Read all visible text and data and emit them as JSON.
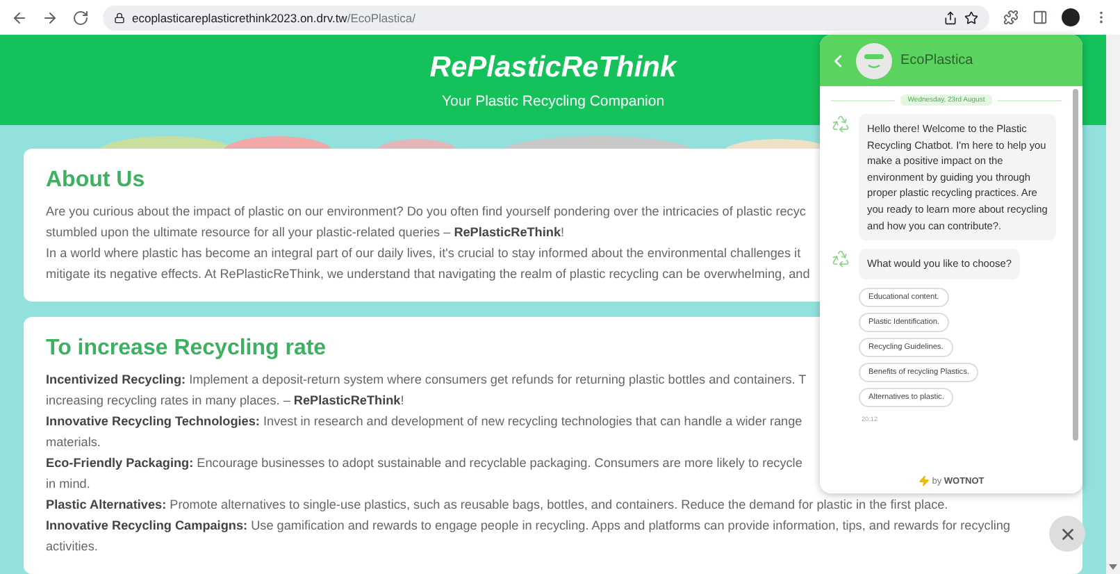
{
  "browser": {
    "url_host": "ecoplasticareplasticrethink2023.on.drv.tw",
    "url_path": "/EcoPlastica/"
  },
  "header": {
    "title": "RePlasticReThink",
    "subtitle": "Your Plastic Recycling Companion"
  },
  "sections": [
    {
      "heading": "About Us",
      "lines": [
        "Are you curious about the impact of plastic on our environment? Do you often find yourself pondering over the intricacies of plastic recyc",
        "stumbled upon the ultimate resource for all your plastic-related queries – **RePlasticReThink**!",
        "In a world where plastic has become an integral part of our daily lives, it's crucial to stay informed about the environmental challenges it",
        "mitigate its negative effects. At RePlasticReThink, we understand that navigating the realm of plastic recycling can be overwhelming, and"
      ]
    },
    {
      "heading": "To increase Recycling rate",
      "lines": [
        "**Incentivized Recycling:** Implement a deposit-return system where consumers get refunds for returning plastic bottles and containers. T",
        "increasing recycling rates in many places. – **RePlasticReThink**!",
        "**Innovative Recycling Technologies:** Invest in research and development of new recycling technologies that can handle a wider range",
        "materials.",
        "**Eco-Friendly Packaging:** Encourage businesses to adopt sustainable and recyclable packaging. Consumers are more likely to recycle",
        "in mind.",
        "**Plastic Alternatives:** Promote alternatives to single-use plastics, such as reusable bags, bottles, and containers. Reduce the demand for plastic in the first place.",
        "**Innovative Recycling Campaigns:** Use gamification and rewards to engage people in recycling. Apps and platforms can provide information, tips, and rewards for recycling",
        "activities."
      ]
    }
  ],
  "chat": {
    "title": "EcoPlastica",
    "date": "Wednesday, 23rd August",
    "messages": [
      {
        "text": "Hello there! Welcome to the Plastic Recycling Chatbot. I'm here to help you make a positive impact on the environment by guiding you through proper plastic recycling practices. Are you ready to learn more about recycling and how you can contribute?."
      },
      {
        "text": "What would you like to choose?"
      }
    ],
    "options": [
      "Educational content.",
      "Plastic Identification.",
      "Recycling Guidelines.",
      "Benefits of recycling Plastics.",
      "Alternatives to plastic."
    ],
    "time": "20:12",
    "footer": "by **WOTNOT**"
  }
}
